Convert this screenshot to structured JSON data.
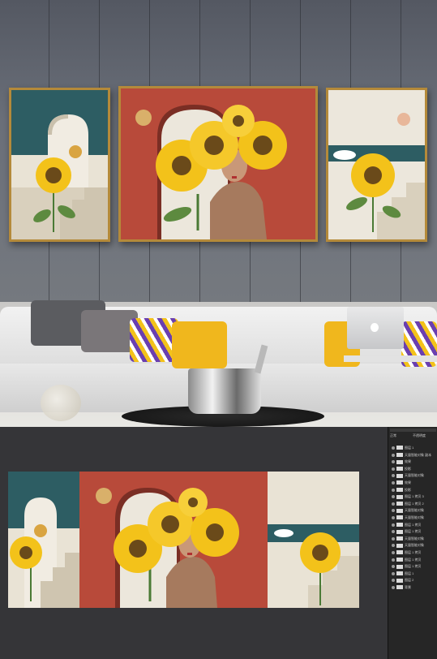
{
  "scene": {
    "description_colors": {
      "wall": "#5f636c",
      "frame_gold": "#b48a3a",
      "teal": "#2d5d63",
      "terracotta": "#b84a3a",
      "sunflower_yellow": "#f3c21a",
      "sofa": "#e6e6e6"
    }
  },
  "layers_panel": {
    "mode_label": "正常",
    "opacity_label": "不透明度",
    "rows": [
      {
        "label": "图层 1",
        "selected": false
      },
      {
        "label": "天量智能对象 副本",
        "selected": false
      },
      {
        "label": "效果",
        "selected": false
      },
      {
        "label": "投影",
        "selected": false
      },
      {
        "label": "天量智能对象",
        "selected": false
      },
      {
        "label": "效果",
        "selected": false
      },
      {
        "label": "投影",
        "selected": false
      },
      {
        "label": "图层 1 拷贝 3",
        "selected": false
      },
      {
        "label": "图层 1 拷贝 2",
        "selected": false
      },
      {
        "label": "天量智能对象",
        "selected": false
      },
      {
        "label": "天量智能对象",
        "selected": false
      },
      {
        "label": "图层 1 拷贝",
        "selected": false
      },
      {
        "label": "图层 1 拷贝",
        "selected": false
      },
      {
        "label": "天量智能对象",
        "selected": false
      },
      {
        "label": "天量智能对象",
        "selected": false
      },
      {
        "label": "图层 1 拷贝",
        "selected": false
      },
      {
        "label": "图层 1 拷贝",
        "selected": false
      },
      {
        "label": "图层 1 拷贝",
        "selected": false
      },
      {
        "label": "图层 1",
        "selected": false
      },
      {
        "label": "图层 2",
        "selected": false
      },
      {
        "label": "背景",
        "selected": false
      }
    ]
  }
}
